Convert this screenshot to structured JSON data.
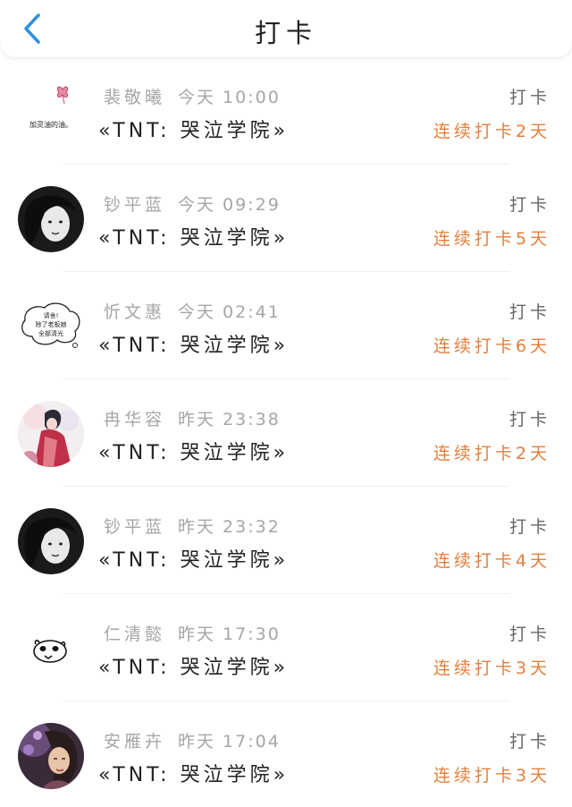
{
  "header": {
    "title": "打卡",
    "back_icon": "chevron-left-icon",
    "accent_color": "#2f8fe6"
  },
  "entries": [
    {
      "name": "裴敬曦",
      "time": "今天 10:00",
      "title": "«TNT: 哭泣学院»",
      "action": "打卡",
      "streak": "连续打卡2天",
      "avatar": "doodle-text-avatar",
      "avatar_text": "加灵油的油。"
    },
    {
      "name": "钞平蓝",
      "time": "今天 09:29",
      "title": "«TNT: 哭泣学院»",
      "action": "打卡",
      "streak": "连续打卡5天",
      "avatar": "photo-avatar-dark"
    },
    {
      "name": "忻文惠",
      "time": "今天 02:41",
      "title": "«TNT: 哭泣学院»",
      "action": "打卡",
      "streak": "连续打卡6天",
      "avatar": "speech-bubble-avatar",
      "avatar_text": [
        "请舍!",
        "除了老板娘",
        "全部清光"
      ]
    },
    {
      "name": "冉华容",
      "time": "昨天 23:38",
      "title": "«TNT: 哭泣学院»",
      "action": "打卡",
      "streak": "连续打卡2天",
      "avatar": "illustration-avatar"
    },
    {
      "name": "钞平蓝",
      "time": "昨天 23:32",
      "title": "«TNT: 哭泣学院»",
      "action": "打卡",
      "streak": "连续打卡4天",
      "avatar": "photo-avatar-dark"
    },
    {
      "name": "仁清懿",
      "time": "昨天 17:30",
      "title": "«TNT: 哭泣学院»",
      "action": "打卡",
      "streak": "连续打卡3天",
      "avatar": "panda-doodle-avatar"
    },
    {
      "name": "安雁卉",
      "time": "昨天 17:04",
      "title": "«TNT: 哭泣学院»",
      "action": "打卡",
      "streak": "连续打卡3天",
      "avatar": "photo-avatar-purple"
    }
  ],
  "colors": {
    "streak": "#e47f3b",
    "meta": "#a6a6a6",
    "title": "#222222"
  }
}
